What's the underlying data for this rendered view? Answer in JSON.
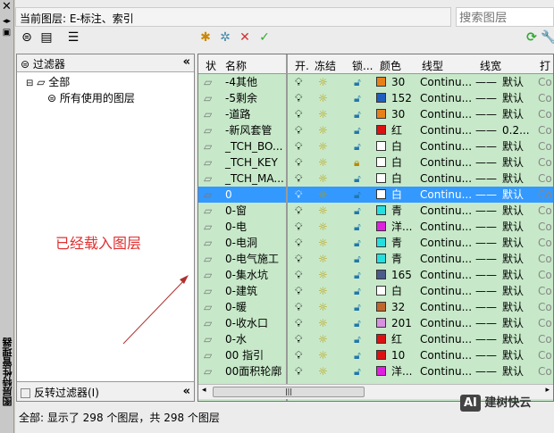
{
  "side_title": "图层特性管理器",
  "current_layer": "当前图层: E-标注、索引",
  "search_placeholder": "搜索图层",
  "filter": {
    "title": "过滤器",
    "tree": [
      "全部",
      "所有使用的图层"
    ],
    "invert_label": "反转过滤器(I)"
  },
  "columns": [
    "状",
    "名称",
    "开.",
    "冻结",
    "锁...",
    "颜色",
    "线型",
    "线宽",
    "打"
  ],
  "rows": [
    {
      "name": "-4其他",
      "color": "#e8801a",
      "color_label": "30",
      "lock": "unlocked",
      "linetype": "Continu...",
      "lineweight": "默认",
      "plot": "Co"
    },
    {
      "name": "-5剩余",
      "color": "#1f5fbf",
      "color_label": "152",
      "lock": "unlocked",
      "linetype": "Continu...",
      "lineweight": "默认",
      "plot": "Co"
    },
    {
      "name": "-道路",
      "color": "#e8801a",
      "color_label": "30",
      "lock": "unlocked",
      "linetype": "Continu...",
      "lineweight": "默认",
      "plot": "Co"
    },
    {
      "name": "-新风套管",
      "color": "#dd1111",
      "color_label": "红",
      "lock": "unlocked",
      "linetype": "Continu...",
      "lineweight": "0.2...",
      "plot": "Co"
    },
    {
      "name": "_TCH_BO...",
      "color": "#ffffff",
      "color_label": "白",
      "lock": "unlocked",
      "linetype": "Continu...",
      "lineweight": "默认",
      "plot": "Co"
    },
    {
      "name": "_TCH_KEY",
      "color": "#ffffff",
      "color_label": "白",
      "lock": "locked",
      "linetype": "Continu...",
      "lineweight": "默认",
      "plot": "Co"
    },
    {
      "name": "_TCH_MA...",
      "color": "#ffffff",
      "color_label": "白",
      "lock": "unlocked",
      "linetype": "Continu...",
      "lineweight": "默认",
      "plot": "Co"
    },
    {
      "name": "0",
      "color": "#ffffff",
      "color_label": "白",
      "lock": "unlocked",
      "linetype": "Continu...",
      "lineweight": "默认",
      "plot": "Co",
      "selected": true
    },
    {
      "name": "0-窗",
      "color": "#22e0e0",
      "color_label": "青",
      "lock": "unlocked",
      "linetype": "Continu...",
      "lineweight": "默认",
      "plot": "Co"
    },
    {
      "name": "0-电",
      "color": "#e020e0",
      "color_label": "洋...",
      "lock": "unlocked",
      "linetype": "Continu...",
      "lineweight": "默认",
      "plot": "Co"
    },
    {
      "name": "0-电洞",
      "color": "#22e0e0",
      "color_label": "青",
      "lock": "unlocked",
      "linetype": "Continu...",
      "lineweight": "默认",
      "plot": "Co"
    },
    {
      "name": "0-电气施工",
      "color": "#22e0e0",
      "color_label": "青",
      "lock": "unlocked",
      "linetype": "Continu...",
      "lineweight": "默认",
      "plot": "Co"
    },
    {
      "name": "0-集水坑",
      "color": "#4a5a8a",
      "color_label": "165",
      "lock": "unlocked",
      "linetype": "Continu...",
      "lineweight": "默认",
      "plot": "Co"
    },
    {
      "name": "0-建筑",
      "color": "#ffffff",
      "color_label": "白",
      "lock": "unlocked",
      "linetype": "Continu...",
      "lineweight": "默认",
      "plot": "Co"
    },
    {
      "name": "0-暖",
      "color": "#c0662a",
      "color_label": "32",
      "lock": "unlocked",
      "linetype": "Continu...",
      "lineweight": "默认",
      "plot": "Co"
    },
    {
      "name": "0-收水口",
      "color": "#d890e0",
      "color_label": "201",
      "lock": "unlocked",
      "linetype": "Continu...",
      "lineweight": "默认",
      "plot": "Co"
    },
    {
      "name": "0-水",
      "color": "#dd1111",
      "color_label": "红",
      "lock": "unlocked",
      "linetype": "Continu...",
      "lineweight": "默认",
      "plot": "Co"
    },
    {
      "name": "00 指引",
      "color": "#dd1111",
      "color_label": "10",
      "lock": "unlocked",
      "linetype": "Continu...",
      "lineweight": "默认",
      "plot": "Co"
    },
    {
      "name": "00面积轮廓",
      "color": "#e020e0",
      "color_label": "洋...",
      "lock": "unlocked",
      "linetype": "Continu...",
      "lineweight": "默认",
      "plot": "Co"
    }
  ],
  "status": "全部: 显示了 298 个图层，共 298 个图层",
  "annotation": "已经载入图层",
  "watermark": "AI 建树快云"
}
